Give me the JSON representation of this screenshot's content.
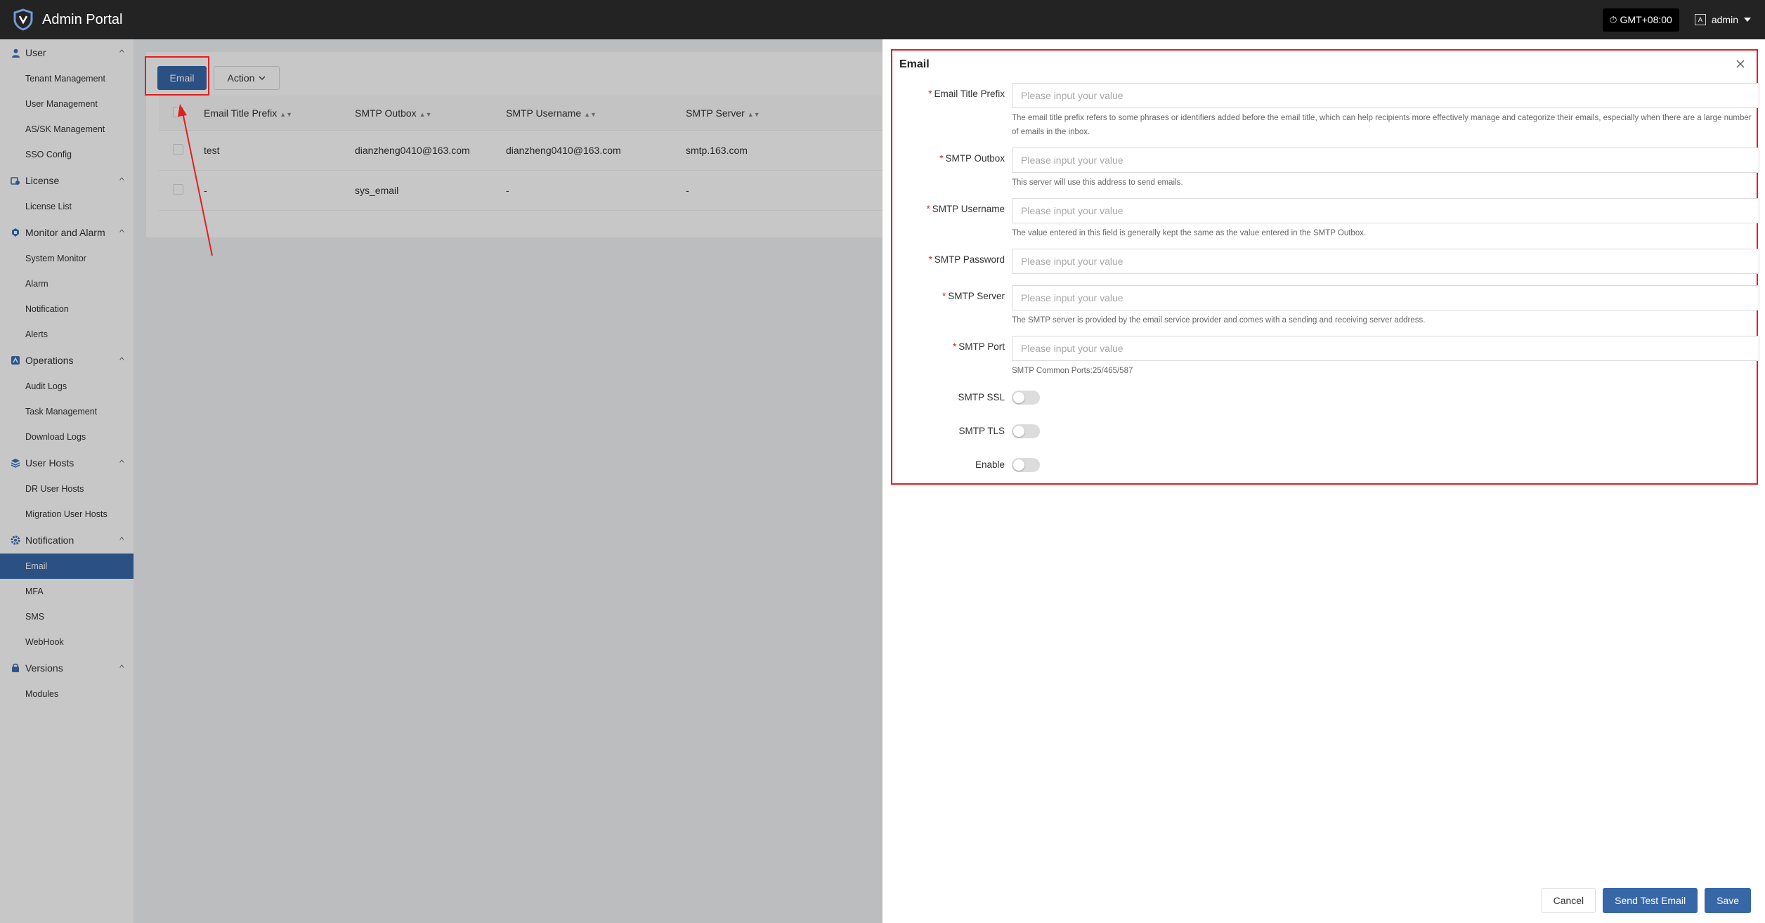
{
  "header": {
    "brand": "Admin Portal",
    "timezone": "GMT+08:00",
    "user": "admin",
    "icons": [
      "shield-logo-icon",
      "clock-icon",
      "user-avatar-icon",
      "caret-down-icon"
    ]
  },
  "sidebar": {
    "groups": [
      {
        "label": "User",
        "icon": "user-icon",
        "items": [
          "Tenant Management",
          "User Management",
          "AS/SK Management",
          "SSO Config"
        ]
      },
      {
        "label": "License",
        "icon": "license-icon",
        "items": [
          "License List"
        ]
      },
      {
        "label": "Monitor and Alarm",
        "icon": "monitor-icon",
        "items": [
          "System Monitor",
          "Alarm",
          "Notification",
          "Alerts"
        ]
      },
      {
        "label": "Operations",
        "icon": "operations-icon",
        "items": [
          "Audit Logs",
          "Task Management",
          "Download Logs"
        ]
      },
      {
        "label": "User Hosts",
        "icon": "layers-icon",
        "items": [
          "DR User Hosts",
          "Migration User Hosts"
        ]
      },
      {
        "label": "Notification",
        "icon": "gear-icon",
        "items": [
          "Email",
          "MFA",
          "SMS",
          "WebHook"
        ]
      },
      {
        "label": "Versions",
        "icon": "versions-icon",
        "items": [
          "Modules"
        ]
      }
    ],
    "active_item": "Email"
  },
  "toolbar": {
    "email_label": "Email",
    "action_label": "Action"
  },
  "table": {
    "columns": [
      "Email Title Prefix",
      "SMTP Outbox",
      "SMTP Username",
      "SMTP Server"
    ],
    "rows": [
      [
        "test",
        "dianzheng0410@163.com",
        "dianzheng0410@163.com",
        "smtp.163.com"
      ],
      [
        "-",
        "sys_email",
        "-",
        "-"
      ]
    ]
  },
  "drawer": {
    "title": "Email",
    "fields": {
      "title_prefix": {
        "label": "Email Title Prefix",
        "placeholder": "Please input your value",
        "help": "The email title prefix refers to some phrases or identifiers added before the email title, which can help recipients more effectively manage and categorize their emails, especially when there are a large number of emails in the inbox."
      },
      "outbox": {
        "label": "SMTP Outbox",
        "placeholder": "Please input your value",
        "help": "This server will use this address to send emails."
      },
      "username": {
        "label": "SMTP Username",
        "placeholder": "Please input your value",
        "help": "The value entered in this field is generally kept the same as the value entered in the SMTP Outbox."
      },
      "password": {
        "label": "SMTP Password",
        "placeholder": "Please input your value"
      },
      "server": {
        "label": "SMTP Server",
        "placeholder": "Please input your value",
        "help": "The SMTP server is provided by the email service provider and comes with a sending and receiving server address."
      },
      "port": {
        "label": "SMTP Port",
        "placeholder": "Please input your value",
        "help": "SMTP Common Ports:25/465/587"
      },
      "ssl": {
        "label": "SMTP SSL",
        "enabled": false
      },
      "tls": {
        "label": "SMTP TLS",
        "enabled": false
      },
      "enable": {
        "label": "Enable",
        "enabled": false
      }
    },
    "buttons": {
      "cancel": "Cancel",
      "send_test": "Send Test Email",
      "save": "Save"
    }
  },
  "colors": {
    "primary": "#3867a8",
    "header_bg": "#232323",
    "highlight": "#e02020"
  }
}
